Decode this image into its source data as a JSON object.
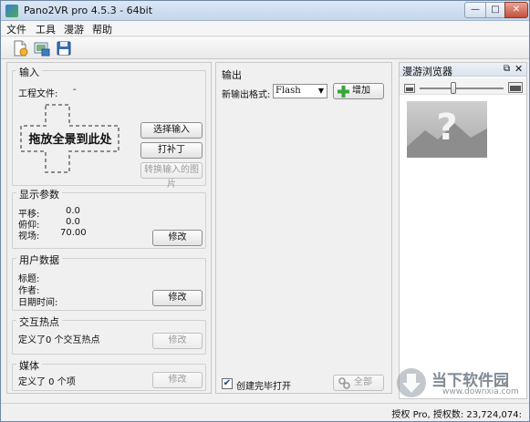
{
  "window": {
    "title": "Pano2VR pro 4.5.3 - 64bit",
    "controls": {
      "minimize": "—",
      "maximize": "□",
      "close": "✕"
    }
  },
  "menu": {
    "items": [
      "文件",
      "工具",
      "漫游",
      "帮助"
    ]
  },
  "toolbar": {
    "icons": [
      "new-project-icon",
      "open-icon",
      "save-icon"
    ]
  },
  "input_group": {
    "title": "输入",
    "project_file_label": "工程文件:",
    "project_file_value": "-",
    "drop_text": "拖放全景到此处",
    "select_input_button": "选择输入",
    "patch_button": "打补丁",
    "convert_button": "转换输入的图片"
  },
  "display_group": {
    "title": "显示参数",
    "pan_label": "平移:",
    "pan_value": "0.0",
    "tilt_label": "俯仰:",
    "tilt_value": "0.0",
    "fov_label": "视场:",
    "fov_value": "70.00",
    "modify_button": "修改"
  },
  "userdata_group": {
    "title": "用户数据",
    "title_label": "标题:",
    "author_label": "作者:",
    "datetime_label": "日期时间:",
    "modify_button": "修改"
  },
  "hotspot_group": {
    "title": "交互热点",
    "summary": "定义了0 个交互热点",
    "modify_button": "修改"
  },
  "media_group": {
    "title": "媒体",
    "summary": "定义了 0 个项",
    "modify_button": "修改"
  },
  "output_group": {
    "title": "输出",
    "format_label": "新输出格式:",
    "format_value": "Flash",
    "add_button": "增加",
    "open_on_finish_label": "创建完毕打开",
    "open_on_finish_checked": true,
    "all_button": "全部"
  },
  "tour_browser": {
    "title": "漫游浏览器",
    "zoom_level": 0.4
  },
  "statusbar": {
    "license": "授权 Pro, 授权数: 23,724,074:"
  },
  "watermark": {
    "brand": "当下软件园",
    "url": "www.downxia.com"
  },
  "colors": {
    "add_green": "#3aa53a",
    "window_border": "#6f87a3",
    "close_red": "#c4503c"
  }
}
